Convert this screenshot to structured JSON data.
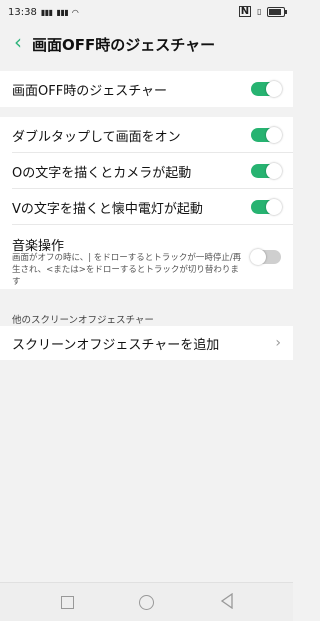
{
  "status": {
    "time": "13:38",
    "signal1": "4G",
    "signal2": "4G",
    "net": "0.00 K/s",
    "nfc": "N"
  },
  "header": {
    "title": "画面OFF時のジェスチャー"
  },
  "master": {
    "label": "画面OFF時のジェスチャー",
    "enabled": true
  },
  "gestures": [
    {
      "label": "ダブルタップして画面をオン",
      "enabled": true
    },
    {
      "label": "Oの文字を描くとカメラが起動",
      "enabled": true
    },
    {
      "label": "Vの文字を描くと懐中電灯が起動",
      "enabled": true
    }
  ],
  "music": {
    "label": "音楽操作",
    "description": "画面がオフの時に、| をドローするとトラックが一時停止/再生され、<または>をドローするとトラックが切り替わります",
    "enabled": false
  },
  "other": {
    "section_label": "他のスクリーンオフジェスチャー",
    "add_label": "スクリーンオフジェスチャーを追加"
  },
  "colors": {
    "accent": "#27b371",
    "toggle_off": "#cfcfcf",
    "background": "#f2f2f2"
  }
}
